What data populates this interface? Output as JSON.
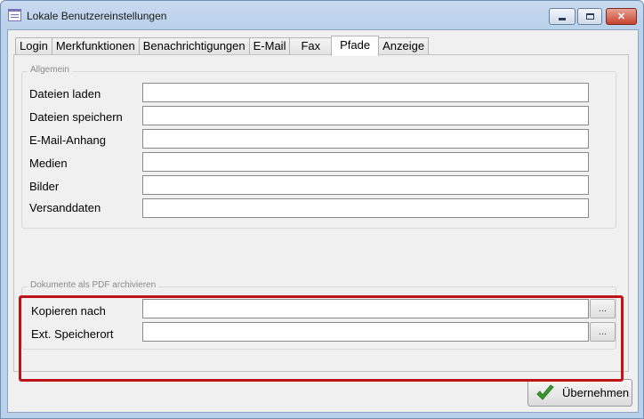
{
  "window": {
    "title": "Lokale Benutzereinstellungen",
    "controls": {
      "minimize": "minimize-icon",
      "maximize": "maximize-icon",
      "close": "✕"
    }
  },
  "tabs": [
    "Login",
    "Merkfunktionen",
    "Benachrichtigungen",
    "E-Mail",
    "Fax",
    "Pfade",
    "Anzeige"
  ],
  "active_tab": "Pfade",
  "groups": {
    "allgemein": {
      "legend": "Allgemein",
      "rows": [
        {
          "label": "Dateien laden",
          "value": ""
        },
        {
          "label": "Dateien speichern",
          "value": ""
        },
        {
          "label": "E-Mail-Anhang",
          "value": ""
        },
        {
          "label": "Medien",
          "value": ""
        },
        {
          "label": "Bilder",
          "value": ""
        },
        {
          "label": "Versanddaten",
          "value": ""
        }
      ]
    },
    "pdf": {
      "legend": "Dokumente als PDF archivieren",
      "rows": [
        {
          "label": "Kopieren nach",
          "value": "",
          "browse": "..."
        },
        {
          "label": "Ext. Speicherort",
          "value": "",
          "browse": "..."
        }
      ]
    }
  },
  "highlight_color": "#c0141b",
  "buttons": {
    "ok": "Übernehmen",
    "ok_icon": "checkmark-icon",
    "ok_icon_color": "#3a9a2e"
  }
}
